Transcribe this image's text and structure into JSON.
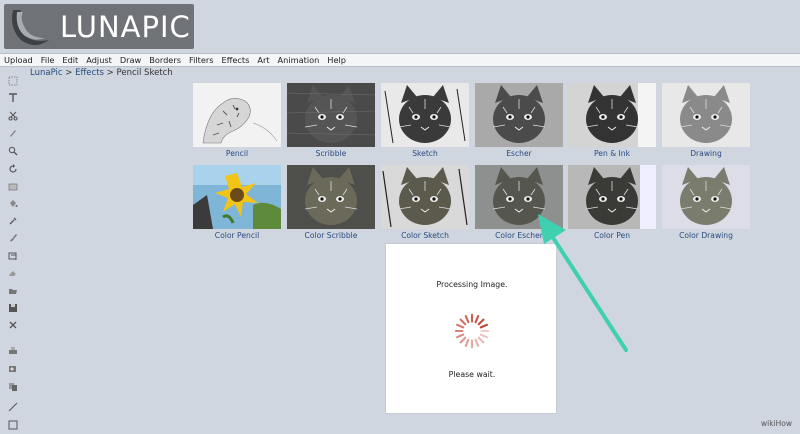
{
  "app": {
    "logo_text": "LUNAPIC"
  },
  "menu": [
    "Upload",
    "File",
    "Edit",
    "Adjust",
    "Draw",
    "Borders",
    "Filters",
    "Effects",
    "Art",
    "Animation",
    "Help"
  ],
  "breadcrumb": {
    "home": "LunaPic",
    "sep1": " > ",
    "section": "Effects",
    "sep2": " > ",
    "current": "Pencil Sketch"
  },
  "toolbar_icons": [
    "select-icon",
    "text-icon",
    "scissors-icon",
    "pencil-icon",
    "zoom-icon",
    "rotate-icon",
    "crop-icon",
    "fill-bucket-icon",
    "eyedropper-icon",
    "brush-icon",
    "layers-icon",
    "eraser-icon",
    "open-folder-icon",
    "save-icon",
    "close-icon",
    "print-icon",
    "rotate-page-icon",
    "copy-icon",
    "line-icon",
    "rectangle-icon"
  ],
  "effects_row1": [
    "Pencil",
    "Scribble",
    "Sketch",
    "Escher",
    "Pen & Ink",
    "Drawing"
  ],
  "effects_row2": [
    "Color Pencil",
    "Color Scribble",
    "Color Sketch",
    "Color Escher",
    "Color Pen",
    "Color Drawing"
  ],
  "dialog": {
    "title": "Processing Image.",
    "wait": "Please wait."
  },
  "watermark": "wikiHow",
  "colors": {
    "accent": "#3fd0b0",
    "link": "#27497a",
    "spinner": "#c0392b"
  }
}
